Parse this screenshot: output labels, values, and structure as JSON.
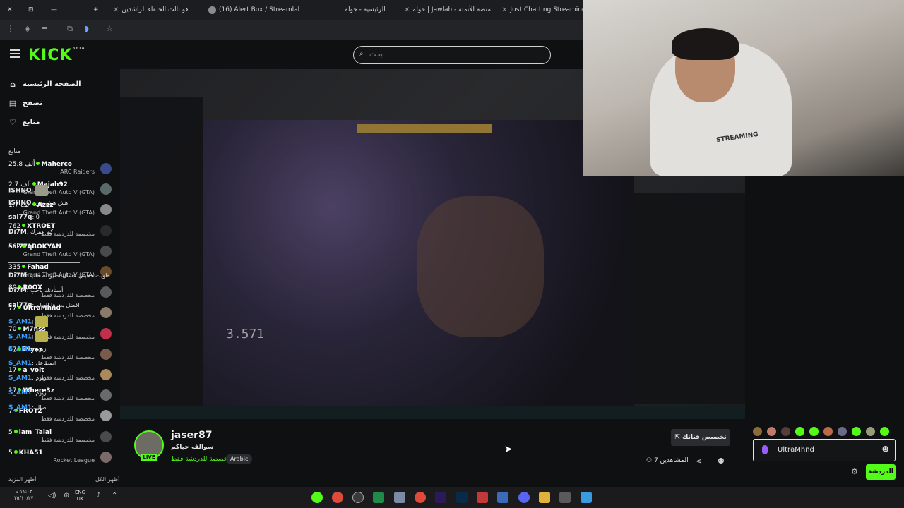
{
  "browser": {
    "tabs": [
      {
        "label": "ما هو ثالث الخلفاء الراشدين"
      },
      {
        "label": "(16) Alert Box / Streamlab"
      },
      {
        "label": "الرئيسية - جولة"
      },
      {
        "label": "حوله | Jawlah - منصة الأتمتة"
      },
      {
        "label": "Just Chatting Streaming"
      }
    ]
  },
  "header": {
    "logo": "KICK",
    "logo_beta": "BETA",
    "search_placeholder": "بحث"
  },
  "sidebar": {
    "nav": [
      {
        "label": "الصفحة الرئيسية",
        "icon": "home-icon"
      },
      {
        "label": "تصفح",
        "icon": "browse-icon"
      },
      {
        "label": "متابع",
        "icon": "heart-icon"
      }
    ],
    "following_heading": "متابع",
    "channels": [
      {
        "viewers": "25.8 ألف",
        "name": "Maherco",
        "category": "ARC Raiders"
      },
      {
        "viewers": "2.7 ألف",
        "name": "Majah92",
        "category": "Grand Theft Auto V (GTA)"
      },
      {
        "viewers": "1.7 ألف",
        "name": "Azzz",
        "category": "Grand Theft Auto V (GTA)"
      },
      {
        "viewers": "762",
        "name": "XTROET",
        "category": "مخصصة للدردشة فقط"
      },
      {
        "viewers": "562",
        "name": "ABOKYAN",
        "category": "Grand Theft Auto V (GTA)"
      },
      {
        "viewers": "335",
        "name": "Fahad",
        "category": "Grand Theft Auto V (GTA)"
      },
      {
        "viewers": "80",
        "name": "R0OX",
        "category": "مخصصة للدردشة فقط"
      },
      {
        "viewers": "77",
        "name": "UltraMhnd",
        "category": "مخصصة للدردشة فقط"
      },
      {
        "viewers": "70",
        "name": "M7nss",
        "category": "مخصصة للدردشة فقط"
      },
      {
        "viewers": "67",
        "name": "iNyez",
        "category": "مخصصة للدردشة فقط"
      },
      {
        "viewers": "17",
        "name": "a_volt",
        "category": "مخصصة للدردشة فقط"
      },
      {
        "viewers": "17",
        "name": "Where3z",
        "category": "مخصصة للدردشة فقط"
      },
      {
        "viewers": "7",
        "name": "FROTZ",
        "category": "مخصصة للدردشة فقط"
      },
      {
        "viewers": "5",
        "name": "iam_Talal",
        "category": "مخصصة للدردشة فقط"
      },
      {
        "viewers": "5",
        "name": "KHA51",
        "category": "Rocket League"
      }
    ],
    "show_more": "أظهر المزيد",
    "show_all": "أظهر الكل"
  },
  "video": {
    "counter": "3.571"
  },
  "webcam": {
    "shirt_text": "STREAMING"
  },
  "chat": {
    "messages": [
      {
        "user": "ISHNO",
        "text": "",
        "emote": true
      },
      {
        "user": "ISHNO",
        "text": "هش هش يس",
        "emote": false
      },
      {
        "user": "sal77q",
        "text": "0",
        "emote": false
      },
      {
        "user": "Di7M",
        "text": "كم عمرك",
        "emote": false
      },
      {
        "user": "sal77q",
        "text": "",
        "emote": false
      },
      {
        "user": "",
        "text": "ـــــــــــــــــــــــــــــــــــــــــــ",
        "emote": false
      },
      {
        "user": "Di7M",
        "text": "طويت حجيتي عشان تصير اصحاب",
        "emote": false
      },
      {
        "user": "Di7M",
        "text": "أستأذنك ياحب",
        "emote": false
      },
      {
        "user": "sal77q",
        "text": "افضل بث فا العالم",
        "emote": false
      },
      {
        "user": "S_AM1",
        "text": "",
        "emote": true
      },
      {
        "user": "S_AM1",
        "text": "",
        "emote": true
      },
      {
        "user": "S_AM1",
        "text": "زيوم",
        "emote": false
      },
      {
        "user": "S_AM1",
        "text": "اصطاعل",
        "emote": false
      },
      {
        "user": "S_AM1",
        "text": "زيوم",
        "emote": false
      },
      {
        "user": "S_AM1",
        "text": "زيوم",
        "emote": false
      },
      {
        "user": "S_AM1",
        "text": "اصال",
        "emote": false
      }
    ],
    "input_value": "UltraMhnd",
    "send_label": "الدردشة"
  },
  "streamer": {
    "name": "jaser87",
    "title": "سوالف حياكم",
    "category": "مخصصة للدردشة فقط",
    "language": "Arabic",
    "live_badge": "LIVE",
    "viewers_label": "المشاهدين",
    "viewers_count": "7",
    "customize_label": "تخصيص قناتك"
  },
  "taskbar": {
    "time": "١١:٠٣ م",
    "date": "٢٥/١٠/٢٧",
    "lang_line1": "ENG",
    "lang_line2": "UK"
  },
  "colors": {
    "brand_green": "#53fc18",
    "bg": "#0f1012"
  }
}
